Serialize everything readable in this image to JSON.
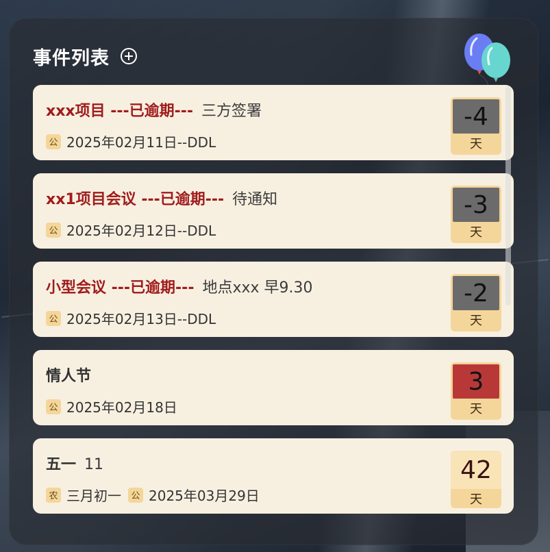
{
  "header": {
    "title": "事件列表",
    "add_icon": "plus-circle-icon",
    "decoration_icon": "balloons-icon"
  },
  "colors": {
    "overdue": "#a01c1c",
    "card_bg": "#f7f0e1",
    "badge_bg": "#f5d69a",
    "soon": "#b83838",
    "past": "#6b6b6b"
  },
  "events": [
    {
      "name": "xxx项目 ---已逾期---",
      "desc": "三方签署",
      "overdue": true,
      "dates": [
        {
          "badge": "公",
          "text": "2025年02月11日--DDL"
        }
      ],
      "days": "-4",
      "unit": "天",
      "state": "past"
    },
    {
      "name": "xx1项目会议 ---已逾期---",
      "desc": "待通知",
      "overdue": true,
      "dates": [
        {
          "badge": "公",
          "text": "2025年02月12日--DDL"
        }
      ],
      "days": "-3",
      "unit": "天",
      "state": "past"
    },
    {
      "name": "小型会议 ---已逾期---",
      "desc": "地点xxx 早9.30",
      "overdue": true,
      "dates": [
        {
          "badge": "公",
          "text": "2025年02月13日--DDL"
        }
      ],
      "days": "-2",
      "unit": "天",
      "state": "past"
    },
    {
      "name": "情人节",
      "desc": "",
      "overdue": false,
      "dates": [
        {
          "badge": "公",
          "text": "2025年02月18日"
        }
      ],
      "days": "3",
      "unit": "天",
      "state": "soon"
    },
    {
      "name": "五一",
      "desc": "11",
      "overdue": false,
      "dates": [
        {
          "badge": "农",
          "text": "三月初一"
        },
        {
          "badge": "公",
          "text": "2025年03月29日"
        }
      ],
      "days": "42",
      "unit": "天",
      "state": "future"
    }
  ]
}
